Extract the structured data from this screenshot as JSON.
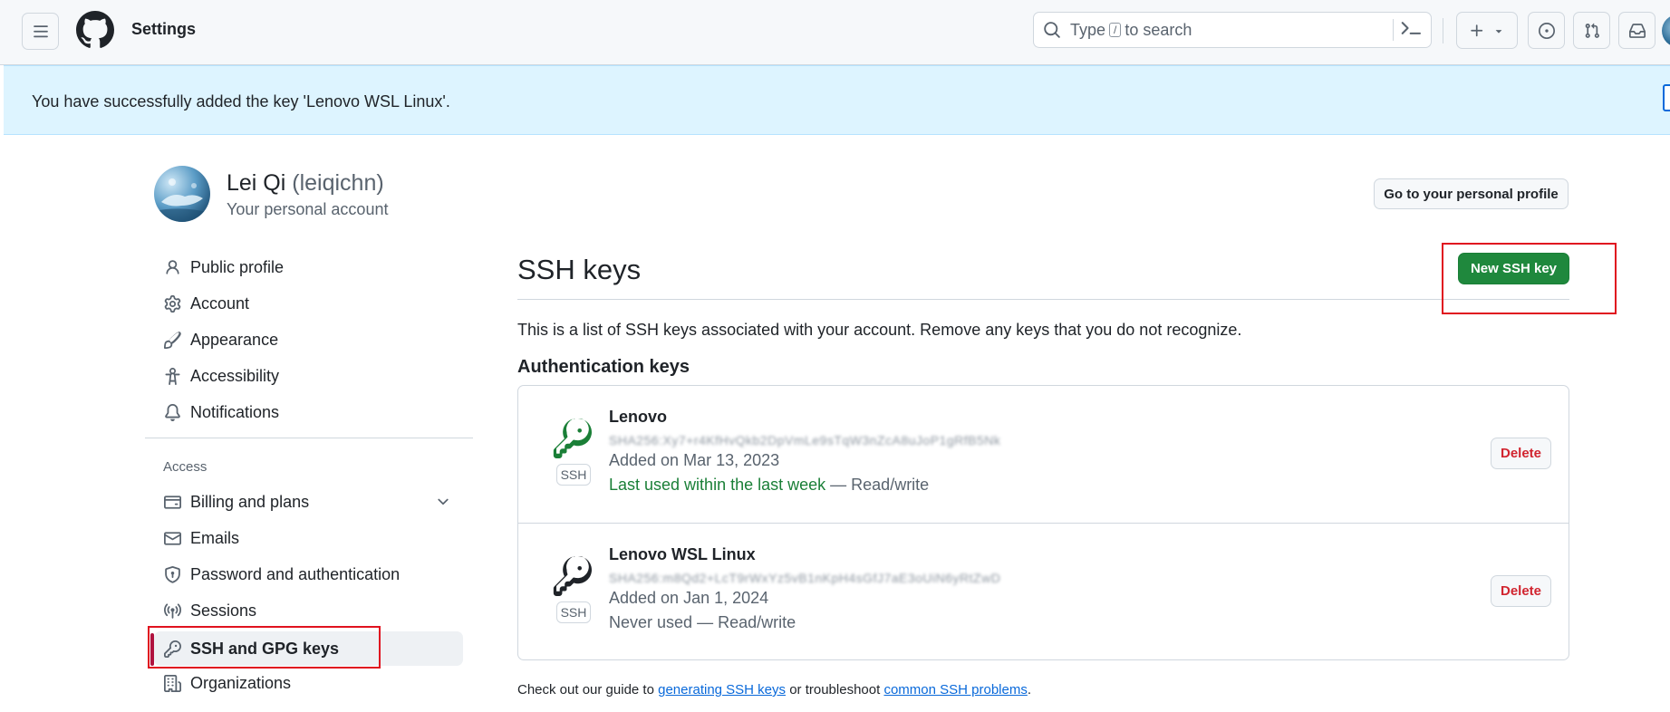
{
  "header": {
    "title": "Settings",
    "search_placeholder_pre": "Type",
    "search_slash": "/",
    "search_placeholder_post": "to search"
  },
  "flash": {
    "message": "You have successfully added the key 'Lenovo WSL Linux'."
  },
  "profile": {
    "name": "Lei Qi",
    "login": "(leiqichn)",
    "subtitle": "Your personal account",
    "go_profile_label": "Go to your personal profile"
  },
  "sidebar": {
    "items": [
      {
        "label": "Public profile",
        "icon": "person-icon"
      },
      {
        "label": "Account",
        "icon": "gear-icon"
      },
      {
        "label": "Appearance",
        "icon": "paintbrush-icon"
      },
      {
        "label": "Accessibility",
        "icon": "accessibility-icon"
      },
      {
        "label": "Notifications",
        "icon": "bell-icon"
      }
    ],
    "access_heading": "Access",
    "access_items": [
      {
        "label": "Billing and plans",
        "icon": "credit-card-icon"
      },
      {
        "label": "Emails",
        "icon": "mail-icon"
      },
      {
        "label": "Password and authentication",
        "icon": "shield-lock-icon"
      },
      {
        "label": "Sessions",
        "icon": "broadcast-icon"
      },
      {
        "label": "SSH and GPG keys",
        "icon": "key-icon",
        "active": true
      },
      {
        "label": "Organizations",
        "icon": "organization-icon"
      }
    ]
  },
  "main": {
    "title": "SSH keys",
    "new_key_label": "New SSH key",
    "intro": "This is a list of SSH keys associated with your account. Remove any keys that you do not recognize.",
    "auth_heading": "Authentication keys",
    "keys": [
      {
        "title": "Lenovo",
        "fingerprint": "SHA256:Xy7+r4KfHvQkb2DpVmLe9sTqW3nZcA8uJoP1gRfB5Nk",
        "added": "Added on Mar 13, 2023",
        "last_used": "Last used within the last week",
        "access": "— Read/write",
        "badge": "SSH",
        "delete_label": "Delete"
      },
      {
        "title": "Lenovo WSL Linux",
        "fingerprint": "SHA256:m8Qd2+LcT9rWxYz5vB1nKpH4sGfJ7aE3oUiN6yRtZwD",
        "added": "Added on Jan 1, 2024",
        "last_used": "Never used",
        "access": "— Read/write",
        "badge": "SSH",
        "delete_label": "Delete"
      }
    ],
    "footer_pre": "Check out our guide to",
    "footer_link1": "generating SSH keys",
    "footer_mid": "or troubleshoot",
    "footer_link2": "common SSH problems",
    "footer_post": "."
  },
  "colors": {
    "primary_button": "#1f883d",
    "flash_bg": "#ddf4ff",
    "annotation": "#e0121f",
    "danger": "#d1242f",
    "active_indicator": "#b0123e"
  }
}
